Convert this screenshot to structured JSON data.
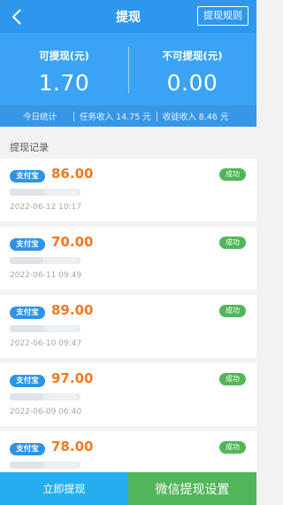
{
  "header": {
    "title": "提现",
    "rule_label": "提现规则",
    "back_icon": "chevron-left-icon"
  },
  "summary": {
    "withdrawable_label": "可提现(元)",
    "withdrawable_value": "1.70",
    "non_withdrawable_label": "不可提现(元)",
    "non_withdrawable_value": "0.00"
  },
  "stats": {
    "today": "今日统计",
    "task_income": "任务收入 14.75 元",
    "apprentice_income": "收徒收入 8.46 元"
  },
  "section": {
    "title": "提现记录"
  },
  "records": [
    {
      "method": "支付宝",
      "amount": "86.00",
      "status": "成功",
      "time": "2022-06-12 10:17"
    },
    {
      "method": "支付宝",
      "amount": "70.00",
      "status": "成功",
      "time": "2022-06-11 09:49"
    },
    {
      "method": "支付宝",
      "amount": "89.00",
      "status": "成功",
      "time": "2022-06-10 09:47"
    },
    {
      "method": "支付宝",
      "amount": "97.00",
      "status": "成功",
      "time": "2022-06-09 06:40"
    },
    {
      "method": "支付宝",
      "amount": "78.00",
      "status": "成功",
      "time": ""
    }
  ],
  "bottom": {
    "withdraw_now": "立即提现",
    "wechat_settings": "微信提现设置"
  },
  "colors": {
    "header_bg": "#2d97ee",
    "amount": "#f07a22",
    "success": "#52b55a",
    "alipay": "#2b94e6"
  }
}
